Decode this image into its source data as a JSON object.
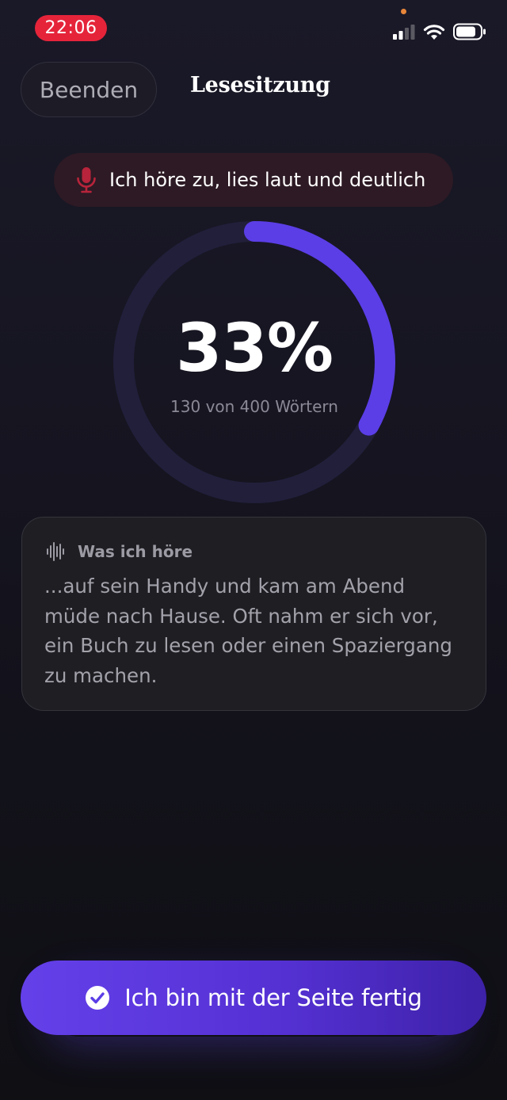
{
  "status_bar": {
    "time": "22:06",
    "icons": [
      "cellular-signal-icon",
      "wifi-icon",
      "battery-icon"
    ]
  },
  "header": {
    "exit_label": "Beenden",
    "title": "Lesesitzung"
  },
  "listening": {
    "icon": "microphone-icon",
    "text": "Ich höre zu, lies laut und deutlich"
  },
  "progress": {
    "percent_label": "33%",
    "fraction": 0.33,
    "words_label": "130 von 400 Wörtern"
  },
  "transcript": {
    "icon": "waveform-icon",
    "label": "Was ich höre",
    "text": "...auf sein Handy und kam am Abend müde nach Hause. Oft nahm er sich vor, ein Buch zu lesen oder einen Spaziergang zu machen."
  },
  "done_button": {
    "icon": "checkmark-circle-icon",
    "label": "Ich bin mit der Seite fertig"
  },
  "colors": {
    "accent": "#5b3ee6",
    "recording": "#e5243a",
    "ring_track": "#211f3a",
    "pill_background": "#2d1a24"
  }
}
